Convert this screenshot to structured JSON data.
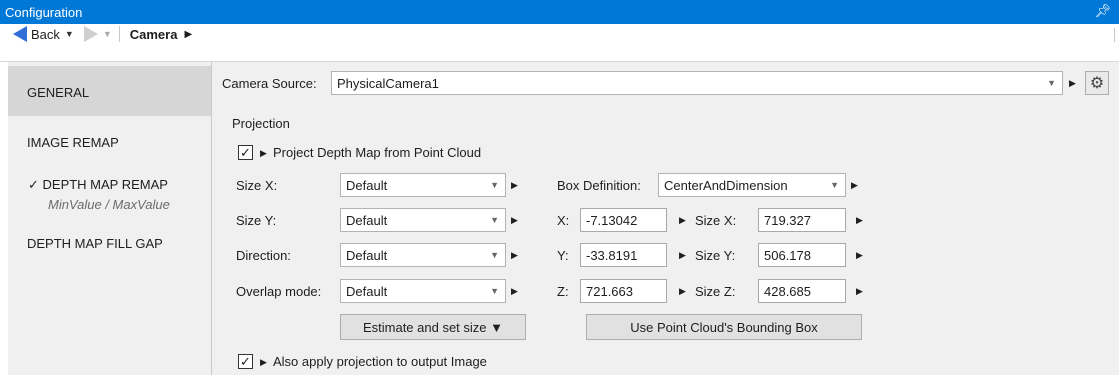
{
  "window": {
    "title": "Configuration",
    "pin_icon": "pin-icon"
  },
  "nav": {
    "back_label": "Back",
    "breadcrumb": "Camera"
  },
  "sidebar": {
    "items": [
      {
        "label": "GENERAL"
      },
      {
        "label": "IMAGE REMAP"
      },
      {
        "label": "✓ DEPTH MAP REMAP",
        "sub": "MinValue / MaxValue"
      },
      {
        "label": "DEPTH MAP FILL GAP"
      }
    ]
  },
  "camera_source": {
    "label": "Camera Source:",
    "value": "PhysicalCamera1"
  },
  "projection": {
    "group_title": "Projection",
    "project_checkbox_label": "Project Depth Map from Point Cloud",
    "project_checked": true,
    "size_x": {
      "label": "Size X:",
      "value": "Default"
    },
    "size_y": {
      "label": "Size Y:",
      "value": "Default"
    },
    "direction": {
      "label": "Direction:",
      "value": "Default"
    },
    "overlap_mode": {
      "label": "Overlap mode:",
      "value": "Default"
    },
    "box_definition": {
      "label": "Box Definition:",
      "value": "CenterAndDimension"
    },
    "x": {
      "label": "X:",
      "value": "-7.13042"
    },
    "y": {
      "label": "Y:",
      "value": "-33.8191"
    },
    "z": {
      "label": "Z:",
      "value": "721.663"
    },
    "box_size_x": {
      "label": "Size X:",
      "value": "719.327"
    },
    "box_size_y": {
      "label": "Size Y:",
      "value": "506.178"
    },
    "box_size_z": {
      "label": "Size Z:",
      "value": "428.685"
    },
    "estimate_button": "Estimate and set size ▼",
    "bounding_box_button": "Use Point Cloud's Bounding Box",
    "apply_checkbox_label": "Also apply projection to output Image",
    "apply_checked": true
  },
  "colors": {
    "title_bar": "#0078d7",
    "panel_bg": "#f0f0f0",
    "active_item_bg": "#d6d6d6"
  }
}
